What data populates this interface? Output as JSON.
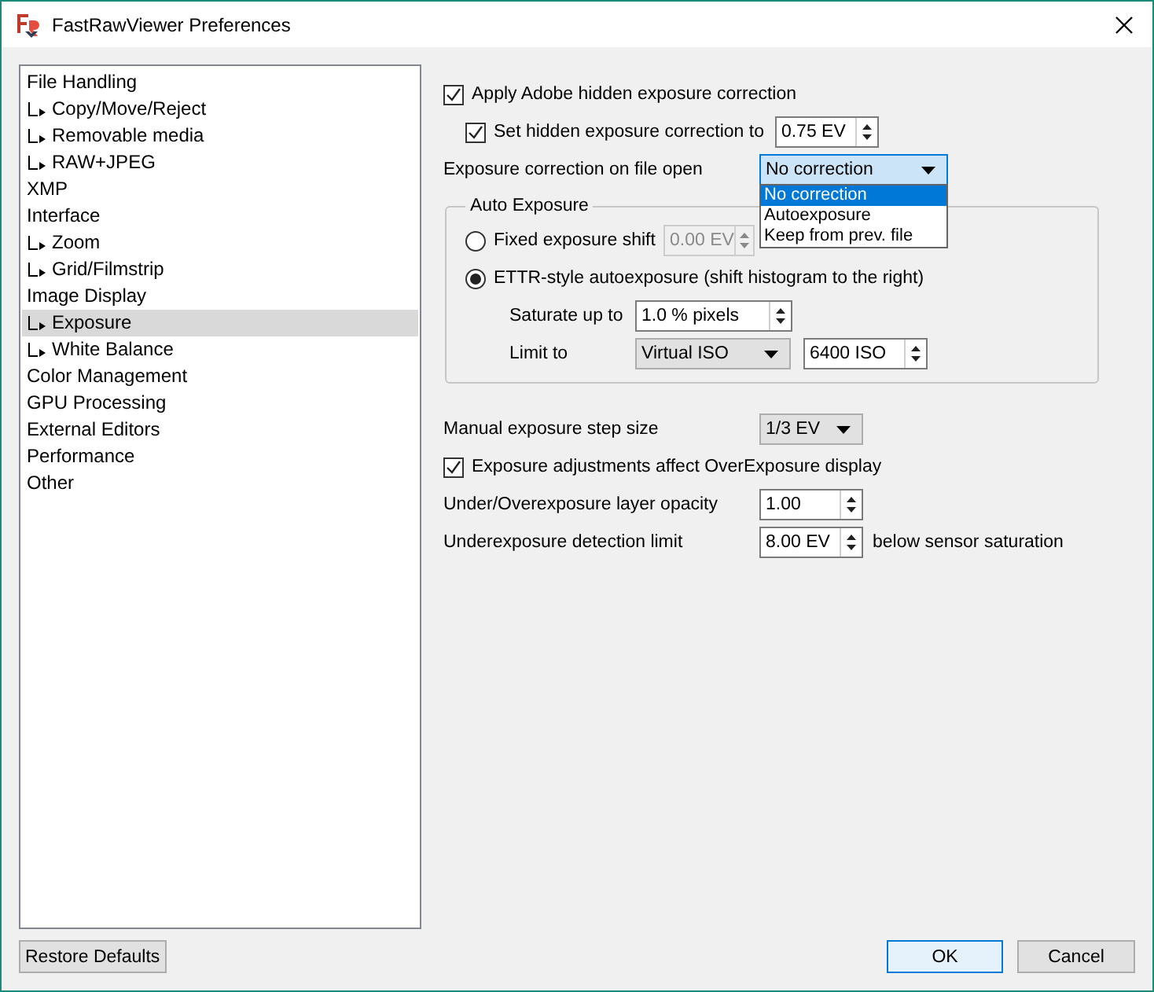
{
  "window": {
    "title": "FastRawViewer Preferences"
  },
  "sidebar": {
    "items": [
      {
        "label": "File Handling",
        "selected": false,
        "children": [
          {
            "label": "Copy/Move/Reject",
            "selected": false
          },
          {
            "label": "Removable media",
            "selected": false
          },
          {
            "label": "RAW+JPEG",
            "selected": false
          }
        ]
      },
      {
        "label": "XMP",
        "selected": false
      },
      {
        "label": "Interface",
        "selected": false,
        "children": [
          {
            "label": "Zoom",
            "selected": false
          },
          {
            "label": "Grid/Filmstrip",
            "selected": false
          }
        ]
      },
      {
        "label": "Image Display",
        "selected": false,
        "children": [
          {
            "label": "Exposure",
            "selected": true
          },
          {
            "label": "White Balance",
            "selected": false
          }
        ]
      },
      {
        "label": "Color Management",
        "selected": false
      },
      {
        "label": "GPU Processing",
        "selected": false
      },
      {
        "label": "External Editors",
        "selected": false
      },
      {
        "label": "Performance",
        "selected": false
      },
      {
        "label": "Other",
        "selected": false
      }
    ]
  },
  "settings": {
    "apply_hidden_correction": {
      "label": "Apply Adobe hidden exposure correction",
      "checked": true
    },
    "set_hidden_correction": {
      "label": "Set hidden exposure correction to",
      "checked": true,
      "value": "0.75 EV"
    },
    "correction_on_open": {
      "label": "Exposure correction on file open",
      "value": "No correction",
      "expanded": true,
      "options": [
        {
          "label": "No correction",
          "selected": true
        },
        {
          "label": "Autoexposure",
          "selected": false
        },
        {
          "label": "Keep from prev. file",
          "selected": false
        }
      ]
    },
    "auto_exposure": {
      "title": "Auto Exposure",
      "fixed_shift": {
        "label": "Fixed exposure shift",
        "selected": false,
        "value": "0.00 EV",
        "disabled": true
      },
      "ettr": {
        "label": "ETTR-style autoexposure (shift histogram to the right)",
        "selected": true
      },
      "saturate": {
        "label": "Saturate up to",
        "value": "1.0 % pixels"
      },
      "limit": {
        "label": "Limit to",
        "mode": "Virtual ISO",
        "value": "6400 ISO"
      }
    },
    "step_size": {
      "label": "Manual exposure step size",
      "value": "1/3 EV"
    },
    "affect_overexposure": {
      "label": "Exposure adjustments affect OverExposure display",
      "checked": true
    },
    "layer_opacity": {
      "label": "Under/Overexposure layer opacity",
      "value": "1.00"
    },
    "detection_limit": {
      "label": "Underexposure detection limit",
      "value": "8.00 EV",
      "suffix": "below sensor saturation"
    }
  },
  "buttons": [
    {
      "label": "Restore Defaults",
      "kind": "reset"
    },
    {
      "label": "OK",
      "kind": "default"
    },
    {
      "label": "Cancel",
      "kind": "plain"
    }
  ]
}
